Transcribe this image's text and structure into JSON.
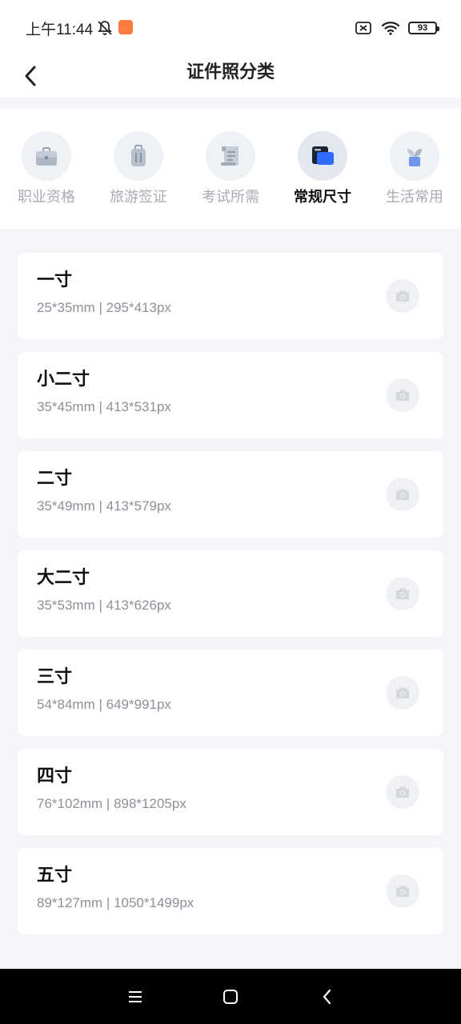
{
  "status_bar": {
    "time": "上午11:44",
    "battery": "93",
    "icons": [
      "bell-off-icon",
      "app-notification-icon",
      "sim-off-icon",
      "wifi-icon",
      "battery-icon"
    ]
  },
  "header": {
    "title": "证件照分类",
    "back_icon": "chevron-left-icon"
  },
  "categories": [
    {
      "label": "职业资格",
      "icon": "briefcase-icon",
      "active": false
    },
    {
      "label": "旅游签证",
      "icon": "suitcase-icon",
      "active": false
    },
    {
      "label": "考试所需",
      "icon": "scroll-icon",
      "active": false
    },
    {
      "label": "常规尺寸",
      "icon": "id-card-icon",
      "active": true
    },
    {
      "label": "生活常用",
      "icon": "plant-icon",
      "active": false
    }
  ],
  "sizes": [
    {
      "name": "一寸",
      "spec": "25*35mm | 295*413px"
    },
    {
      "name": "小二寸",
      "spec": "35*45mm | 413*531px"
    },
    {
      "name": "二寸",
      "spec": "35*49mm | 413*579px"
    },
    {
      "name": "大二寸",
      "spec": "35*53mm | 413*626px"
    },
    {
      "name": "三寸",
      "spec": "54*84mm | 649*991px"
    },
    {
      "name": "四寸",
      "spec": "76*102mm | 898*1205px"
    },
    {
      "name": "五寸",
      "spec": "89*127mm | 1050*1499px"
    }
  ],
  "colors": {
    "accent": "#2f6bff",
    "active_label": "#111111",
    "inactive_label": "#a7abb3",
    "page_bg": "#f3f5f9"
  },
  "nav_bar": {
    "icons": [
      "menu-icon",
      "home-square-icon",
      "back-icon"
    ]
  }
}
